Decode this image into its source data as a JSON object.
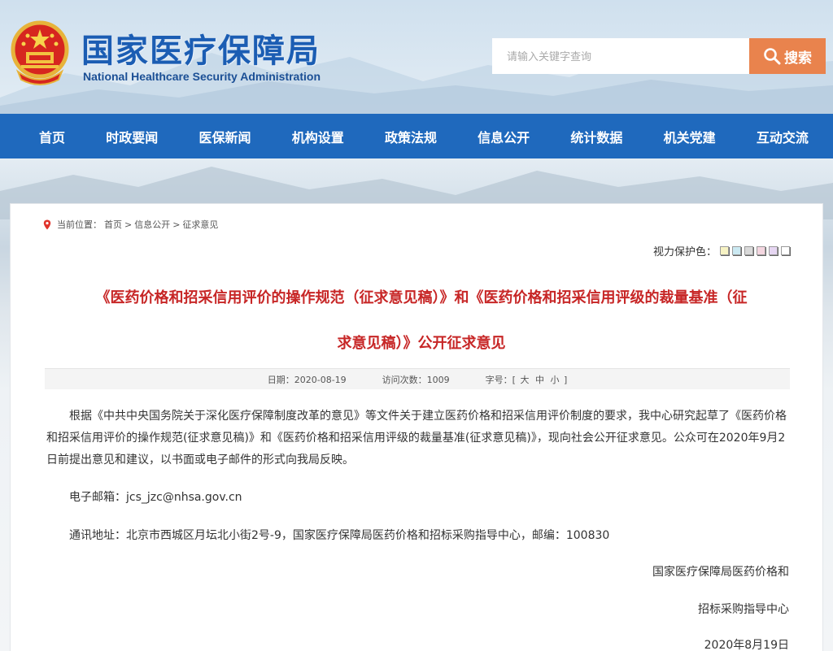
{
  "header": {
    "title_cn": "国家医疗保障局",
    "title_en": "National Healthcare Security Administration",
    "search_placeholder": "请输入关键字查询",
    "search_button": "搜索"
  },
  "nav": {
    "items": [
      "首页",
      "时政要闻",
      "医保新闻",
      "机构设置",
      "政策法规",
      "信息公开",
      "统计数据",
      "机关党建",
      "互动交流"
    ]
  },
  "breadcrumb": {
    "prefix": "当前位置：",
    "items": [
      "首页",
      "信息公开",
      "征求意见"
    ],
    "sep": ">"
  },
  "vision": {
    "label": "视力保护色：",
    "swatches": [
      "#f7f3c4",
      "#cbe9f2",
      "#d9d9d9",
      "#f4d6e0",
      "#e6d6f2",
      "#ffffff"
    ]
  },
  "article": {
    "title_line1": "《医药价格和招采信用评价的操作规范（征求意见稿）》和《医药价格和招采信用评级的裁量基准（征",
    "title_line2": "求意见稿）》公开征求意见",
    "meta": {
      "date_label": "日期：",
      "date": "2020-08-19",
      "visits_label": "访问次数：",
      "visits": "1009",
      "fontsize_label": "字号：",
      "bracket_open": "[",
      "large": "大",
      "medium": "中",
      "small": "小",
      "bracket_close": "]"
    },
    "body": "根据《中共中央国务院关于深化医疗保障制度改革的意见》等文件关于建立医药价格和招采信用评价制度的要求，我中心研究起草了《医药价格和招采信用评价的操作规范(征求意见稿)》和《医药价格和招采信用评级的裁量基准(征求意见稿)》，现向社会公开征求意见。公众可在2020年9月2日前提出意见和建议，以书面或电子邮件的形式向我局反映。",
    "email_label": "电子邮箱：",
    "email": "jcs_jzc@nhsa.gov.cn",
    "address_label": "通讯地址：",
    "address": "北京市西城区月坛北小街2号-9，国家医疗保障局医药价格和招标采购指导中心，邮编：100830",
    "sign_line1": "国家医疗保障局医药价格和",
    "sign_line2": "招标采购指导中心",
    "sign_date": "2020年8月19日"
  },
  "colors": {
    "nav_bg": "#1f69bd",
    "title_red": "#c72626",
    "search_orange": "#e9834d",
    "brand_blue": "#1b5db3"
  }
}
